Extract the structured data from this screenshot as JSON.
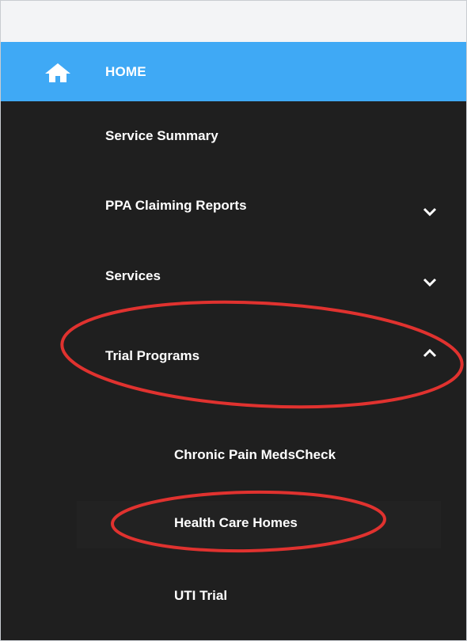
{
  "header": {
    "home_label": "HOME"
  },
  "nav": {
    "items": [
      {
        "label": "Service Summary"
      },
      {
        "label": "PPA Claiming Reports"
      },
      {
        "label": "Services"
      },
      {
        "label": "Trial Programs"
      }
    ],
    "trial_programs_children": [
      {
        "label": "Chronic Pain MedsCheck"
      },
      {
        "label": "Health Care Homes"
      },
      {
        "label": "UTI Trial"
      }
    ]
  },
  "colors": {
    "header_blue": "#3fa9f5",
    "sidebar_bg": "#1f1f1f",
    "annotation_red": "#e0322f"
  },
  "icons": {
    "home": "home-icon",
    "collapsed": "chevron-down-icon",
    "expanded": "chevron-up-icon"
  }
}
